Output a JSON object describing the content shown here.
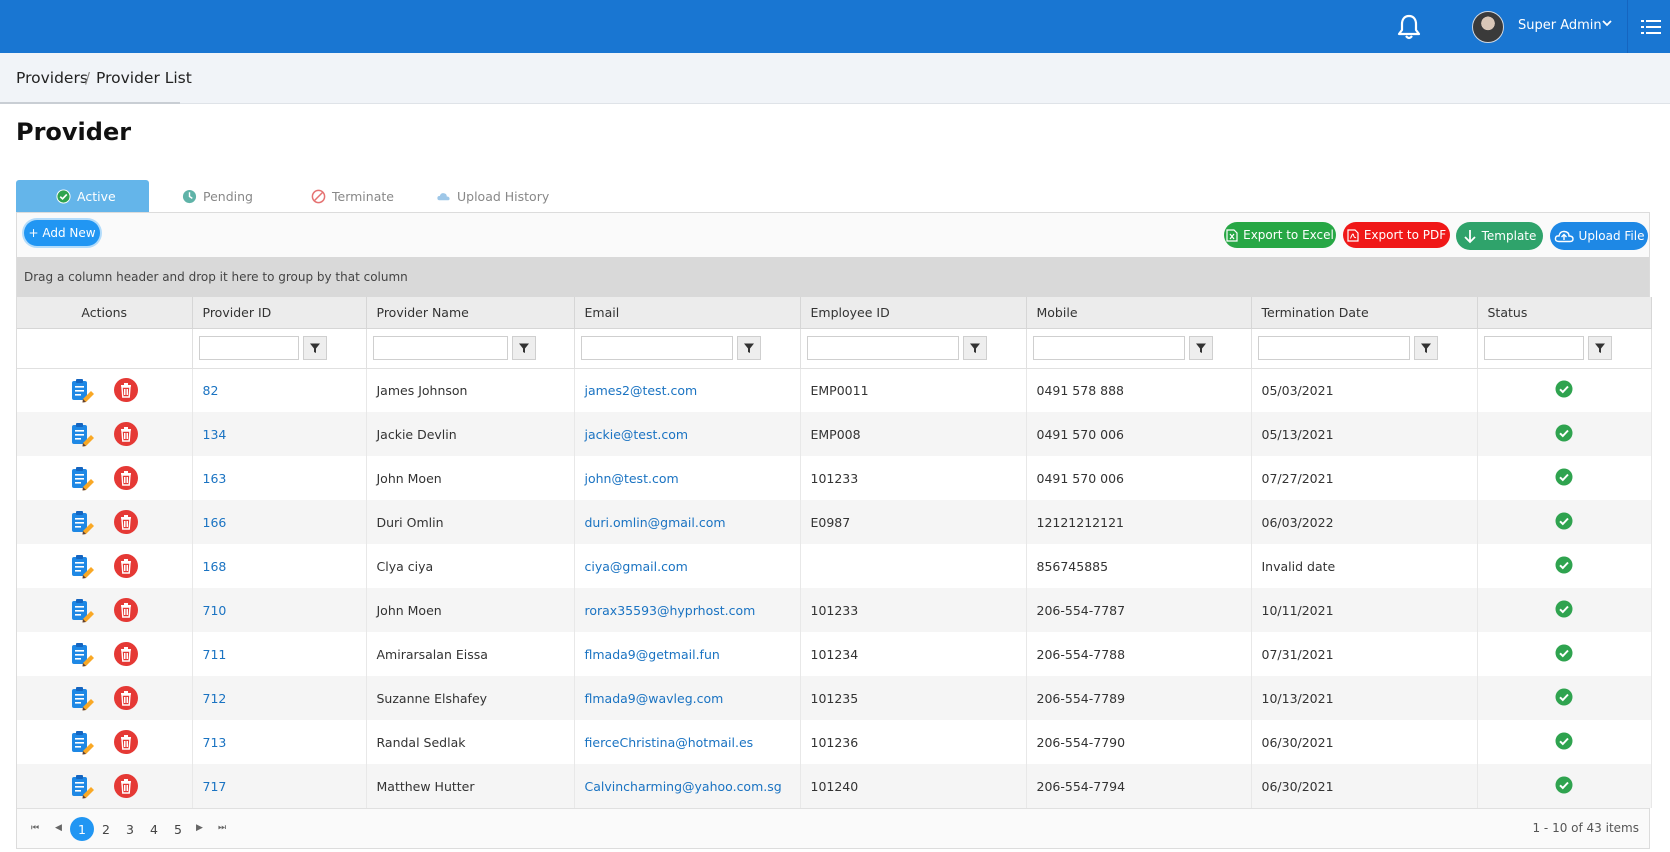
{
  "header": {
    "user_name": "Super Admin"
  },
  "breadcrumb": {
    "root": "Providers",
    "separator": "/",
    "current": "Provider List"
  },
  "page": {
    "title": "Provider"
  },
  "tabs": [
    {
      "label": "Active",
      "icon": "check-circle-icon"
    },
    {
      "label": "Pending",
      "icon": "clock-icon"
    },
    {
      "label": "Terminate",
      "icon": "ban-icon"
    },
    {
      "label": "Upload History",
      "icon": "cloud-icon"
    }
  ],
  "toolbar": {
    "add_label": "+ Add New",
    "export_excel": "Export to Excel",
    "export_pdf": "Export to PDF",
    "template": "Template",
    "upload_file": "Upload File"
  },
  "group_hint": "Drag a column header and drop it here to group by that column",
  "columns": [
    "Actions",
    "Provider ID",
    "Provider Name",
    "Email",
    "Employee ID",
    "Mobile",
    "Termination Date",
    "Status"
  ],
  "rows": [
    {
      "id": "82",
      "name": "James Johnson",
      "email": "james2@test.com",
      "emp": "EMP0011",
      "mobile": "0491 578 888",
      "term": "05/03/2021"
    },
    {
      "id": "134",
      "name": "Jackie Devlin",
      "email": "jackie@test.com",
      "emp": "EMP008",
      "mobile": "0491 570 006",
      "term": "05/13/2021"
    },
    {
      "id": "163",
      "name": "John Moen",
      "email": "john@test.com",
      "emp": "101233",
      "mobile": "0491 570 006",
      "term": "07/27/2021"
    },
    {
      "id": "166",
      "name": "Duri Omlin",
      "email": "duri.omlin@gmail.com",
      "emp": "E0987",
      "mobile": "12121212121",
      "term": "06/03/2022"
    },
    {
      "id": "168",
      "name": "Clya ciya",
      "email": "ciya@gmail.com",
      "emp": "",
      "mobile": "856745885",
      "term": "Invalid date"
    },
    {
      "id": "710",
      "name": "John Moen",
      "email": "rorax35593@hyprhost.com",
      "emp": "101233",
      "mobile": "206-554-7787",
      "term": "10/11/2021"
    },
    {
      "id": "711",
      "name": "Amirarsalan Eissa",
      "email": "flmada9@getmail.fun",
      "emp": "101234",
      "mobile": "206-554-7788",
      "term": "07/31/2021"
    },
    {
      "id": "712",
      "name": "Suzanne Elshafey",
      "email": "flmada9@wavleg.com",
      "emp": "101235",
      "mobile": "206-554-7789",
      "term": "10/13/2021"
    },
    {
      "id": "713",
      "name": "Randal Sedlak",
      "email": "fierceChristina@hotmail.es",
      "emp": "101236",
      "mobile": "206-554-7790",
      "term": "06/30/2021"
    },
    {
      "id": "717",
      "name": "Matthew Hutter",
      "email": "Calvincharming@yahoo.com.sg",
      "emp": "101240",
      "mobile": "206-554-7794",
      "term": "06/30/2021"
    }
  ],
  "pager": {
    "pages": [
      "1",
      "2",
      "3",
      "4",
      "5"
    ],
    "current": "1",
    "info": "1 - 10 of 43 items"
  },
  "colors": {
    "topbar": "#1976d2",
    "active_tab": "#64b5ea",
    "link": "#1a73c2",
    "status_ok": "#2fa34f",
    "delete": "#e53935"
  }
}
